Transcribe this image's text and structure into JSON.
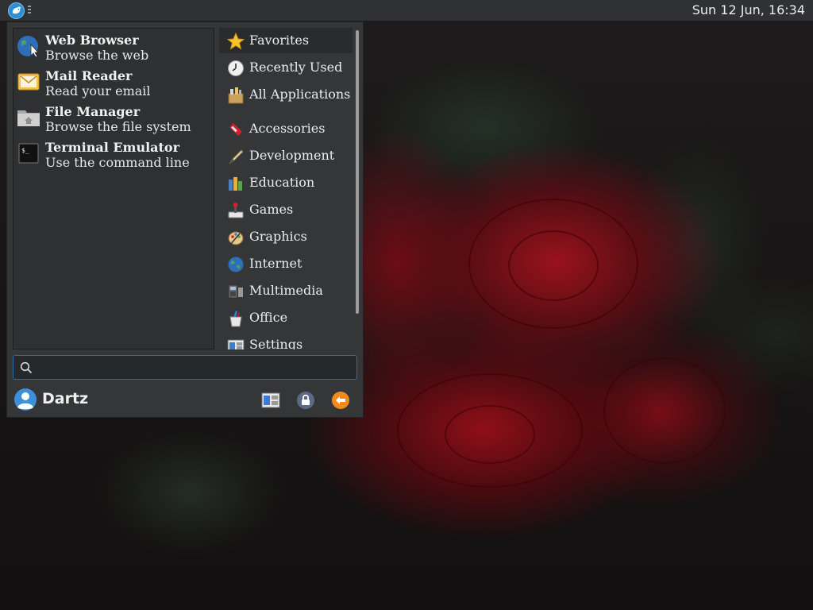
{
  "panel": {
    "clock": "Sun 12 Jun, 16:34",
    "menu_button_icon": "whisker-menu-icon"
  },
  "favorites": [
    {
      "name": "Web Browser",
      "description": "Browse the web",
      "icon": "globe-icon"
    },
    {
      "name": "Mail Reader",
      "description": "Read your email",
      "icon": "mail-icon"
    },
    {
      "name": "File Manager",
      "description": "Browse the file system",
      "icon": "folder-home-icon"
    },
    {
      "name": "Terminal Emulator",
      "description": "Use the command line",
      "icon": "terminal-icon"
    }
  ],
  "categories": [
    {
      "label": "Favorites",
      "icon": "star-icon",
      "selected": true
    },
    {
      "label": "Recently Used",
      "icon": "clock-icon"
    },
    {
      "label": "All Applications",
      "icon": "applications-icon"
    },
    {
      "label": "Accessories",
      "icon": "accessories-icon"
    },
    {
      "label": "Development",
      "icon": "development-icon"
    },
    {
      "label": "Education",
      "icon": "education-icon"
    },
    {
      "label": "Games",
      "icon": "games-icon"
    },
    {
      "label": "Graphics",
      "icon": "graphics-icon"
    },
    {
      "label": "Internet",
      "icon": "internet-icon"
    },
    {
      "label": "Multimedia",
      "icon": "multimedia-icon"
    },
    {
      "label": "Office",
      "icon": "office-icon"
    },
    {
      "label": "Settings",
      "icon": "settings-icon"
    }
  ],
  "search": {
    "value": "",
    "placeholder": ""
  },
  "user": {
    "name": "Dartz"
  },
  "actions": [
    {
      "name": "settings-manager",
      "icon": "settings-manager-icon"
    },
    {
      "name": "lock-screen",
      "icon": "lock-icon"
    },
    {
      "name": "log-out",
      "icon": "log-out-icon"
    }
  ],
  "colors": {
    "panel_bg": "#2f3133",
    "menu_bg": "#353637",
    "accent": "#2e6ea6",
    "wallpaper_rose": "#a0121c"
  }
}
